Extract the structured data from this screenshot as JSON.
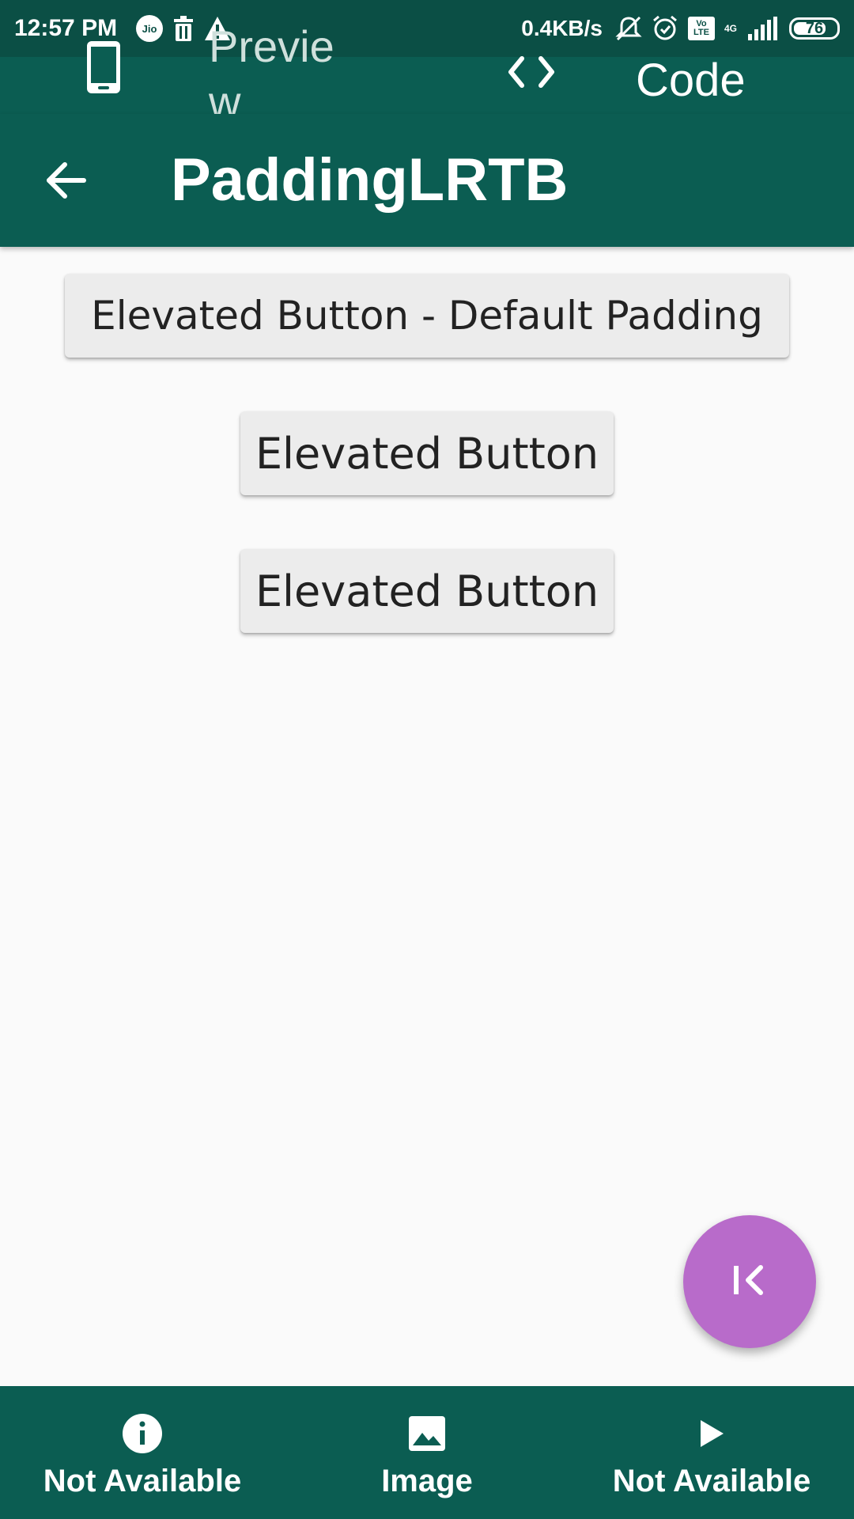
{
  "status_bar": {
    "time": "12:57 PM",
    "carrier_icon_text": "Jio",
    "network_speed": "0.4KB/s",
    "volte_text": "Vo LTE",
    "network_type": "4G",
    "battery_level": 76,
    "battery_text": "76",
    "icons": [
      "jio-icon",
      "delete-icon",
      "warning-icon",
      "mute-icon",
      "alarm-icon",
      "volte-icon",
      "signal-icon",
      "battery-icon"
    ]
  },
  "top_tabs": {
    "preview_label": "Preview",
    "code_label": "Code",
    "icons": [
      "phone-icon",
      "code-icon"
    ]
  },
  "app_bar": {
    "title": "PaddingLRTB",
    "back_icon": "arrow-back-icon"
  },
  "buttons": {
    "default_padding_label": "Elevated Button - Default Padding",
    "button2_label": "Elevated Button",
    "button3_label": "Elevated Button"
  },
  "fab": {
    "icon": "first-page-icon"
  },
  "bottom_nav": {
    "items": [
      {
        "label": "Not Available",
        "icon": "info-icon"
      },
      {
        "label": "Image",
        "icon": "image-icon"
      },
      {
        "label": "Not Available",
        "icon": "play-icon"
      }
    ]
  },
  "colors": {
    "status_bar": "#0b4f45",
    "primary": "#0b5d52",
    "background": "#fafafa",
    "button": "#ececec",
    "fab": "#b86bca"
  }
}
